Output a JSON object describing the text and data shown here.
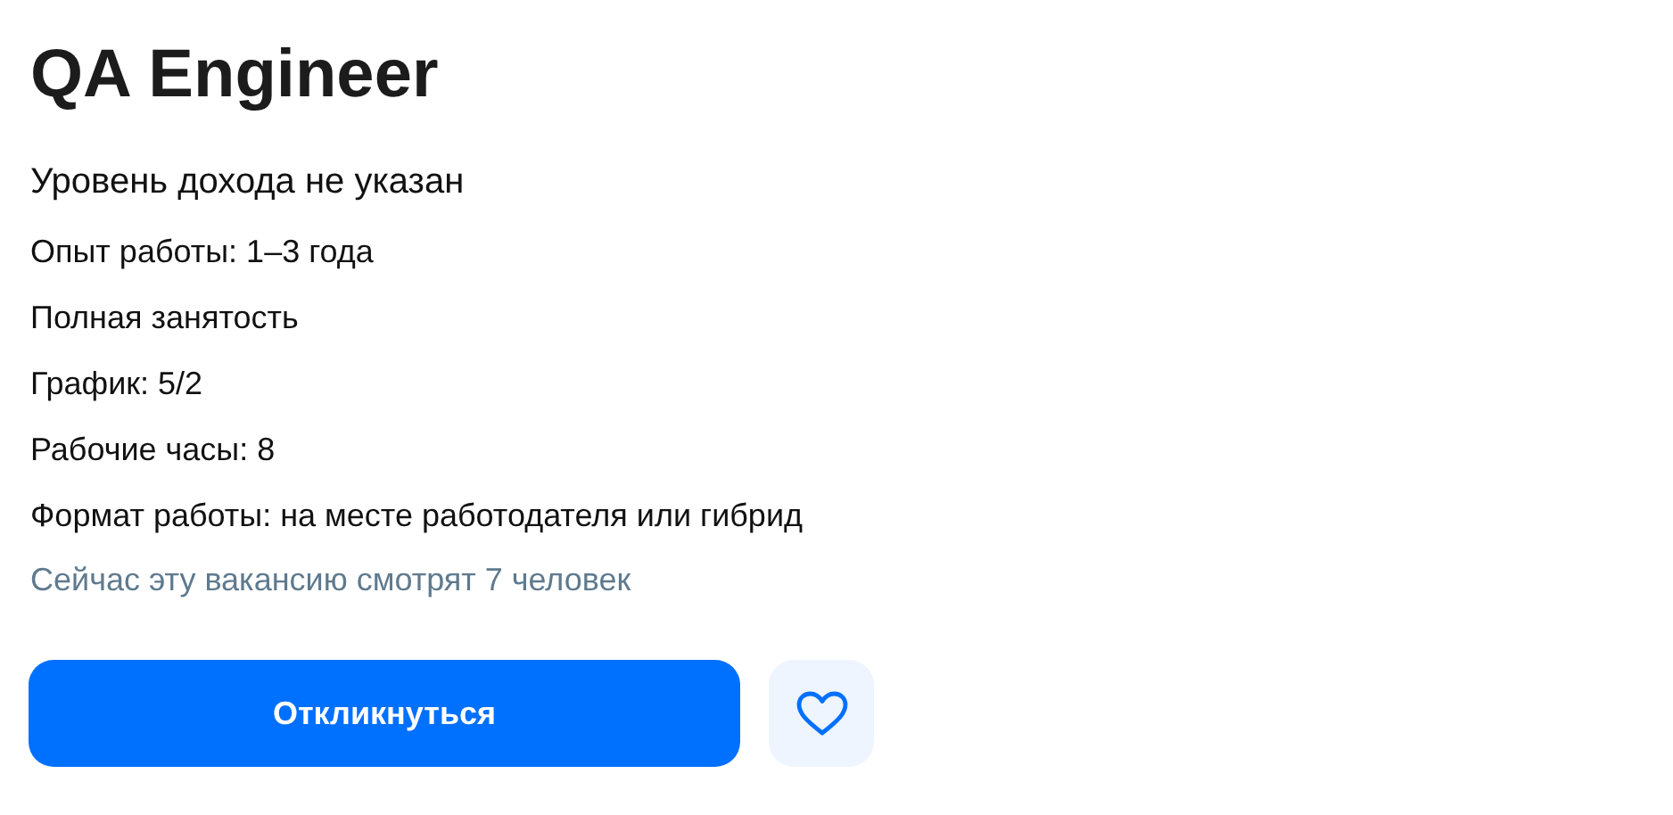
{
  "vacancy": {
    "title": "QA Engineer",
    "salary": "Уровень дохода не указан",
    "details": [
      "Опыт работы: 1–3 года",
      "Полная занятость",
      "График: 5/2",
      "Рабочие часы: 8",
      "Формат работы: на месте работодателя или гибрид"
    ],
    "viewers": "Сейчас эту вакансию смотрят 7 человек",
    "apply_button": "Откликнуться",
    "favorite": {
      "selected": false
    }
  }
}
